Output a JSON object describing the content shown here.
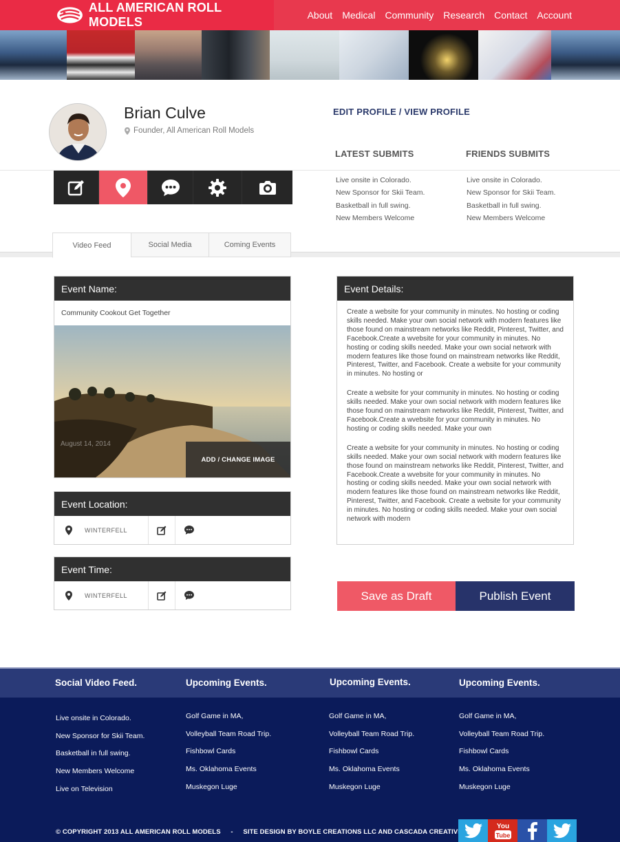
{
  "header": {
    "brand": "ALL AMERICAN ROLL MODELS",
    "nav": [
      "About",
      "Medical",
      "Community",
      "Research",
      "Contact",
      "Account"
    ]
  },
  "profile": {
    "name": "Brian Culve",
    "role": "Founder, All American Roll Models",
    "edit_links": "EDIT PROFILE / VIEW PROFILE",
    "latest_title": "LATEST SUBMITS",
    "friends_title": "FRIENDS SUBMITS",
    "latest": [
      "Live onsite in Colorado.",
      "New Sponsor for Skii Team.",
      "Basketball in full swing.",
      "New Members Welcome"
    ],
    "friends": [
      "Live onsite in Colorado.",
      "New Sponsor for Skii Team.",
      "Basketball in full swing.",
      "New Members Welcome"
    ]
  },
  "toolbar": {
    "icons": [
      "edit-icon",
      "location-pin-icon",
      "chat-bubble-icon",
      "gear-icon",
      "camera-icon"
    ],
    "active": "location-pin-icon"
  },
  "tabs": [
    "Video Feed",
    "Social Media",
    "Coming Events"
  ],
  "event": {
    "name_label": "Event Name:",
    "name_value": "Community Cookout Get Together",
    "photo_date": "August 14, 2014",
    "change_image": "ADD / CHANGE IMAGE",
    "location_label": "Event Location:",
    "location_value": "WINTERFELL",
    "time_label": "Event Time:",
    "time_value": "WINTERFELL",
    "details_label": "Event Details:",
    "details": [
      "Create a website for your community in minutes. No hosting or coding skills needed. Make your own social network with modern features like those found on mainstream networks like Reddit, Pinterest, Twitter, and Facebook.Create a wvebsite for your community in minutes. No hosting or coding skills needed. Make your own social network with modern features like those found on mainstream networks like Reddit, Pinterest, Twitter, and Facebook. Create a website for your community in minutes. No hosting or",
      "Create a website for your community in minutes. No hosting or coding skills needed. Make your own social network with modern features like those found on mainstream networks like Reddit, Pinterest, Twitter, and Facebook.Create a wvebsite for your community in minutes. No hosting or coding skills needed. Make your own",
      "Create a website for your community in minutes. No hosting or coding skills needed. Make your own social network with modern features like those found on mainstream networks like Reddit, Pinterest, Twitter, and Facebook.Create a wvebsite for your community in minutes. No hosting or coding skills needed. Make your own social network with modern features like those found on mainstream networks like Reddit, Pinterest, Twitter, and Facebook. Create a website for your community in minutes. No hosting or coding skills needed. Make your own social network with modern"
    ],
    "save_draft": "Save as Draft",
    "publish": "Publish Event"
  },
  "footer": {
    "columns": [
      {
        "title": "Social Video Feed.",
        "items": [
          "Live onsite in Colorado.",
          "New Sponsor for Skii Team.",
          "Basketball in full swing.",
          "New Members Welcome",
          "Live on Television"
        ]
      },
      {
        "title": "Upcoming Events.",
        "items": [
          "Golf Game in MA,",
          "Volleyball Team Road Trip.",
          "Fishbowl Cards",
          "Ms. Oklahoma Events",
          "Muskegon Luge"
        ]
      },
      {
        "title": "Upcoming Events.",
        "items": [
          "Golf Game in MA,",
          "Volleyball Team Road Trip.",
          "Fishbowl Cards",
          "Ms. Oklahoma Events",
          "Muskegon Luge"
        ]
      },
      {
        "title": "Upcoming Events.",
        "items": [
          "Golf Game in MA,",
          "Volleyball Team Road Trip.",
          "Fishbowl Cards",
          "Ms. Oklahoma Events",
          "Muskegon Luge"
        ]
      }
    ],
    "copyright": "© COPYRIGHT 2013 ALL AMERICAN ROLL MODELS",
    "separator": "-",
    "credit": "SITE DESIGN BY BOYLE CREATIONS LLC AND CASCADA CREATIVE",
    "social": [
      "twitter-icon",
      "youtube-icon",
      "facebook-icon",
      "twitter-icon"
    ]
  },
  "colors": {
    "accent": "#e8394e",
    "coral": "#ef5966",
    "navy": "#27336a",
    "footer": "#0b1b5a",
    "dark": "#303030"
  }
}
